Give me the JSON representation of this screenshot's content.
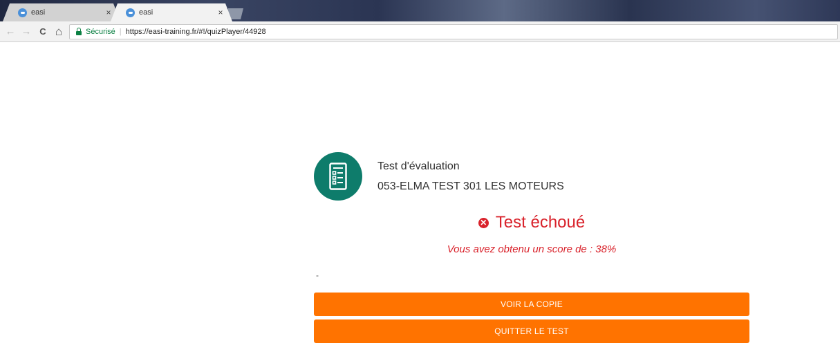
{
  "browser": {
    "tabs": [
      {
        "title": "easi",
        "active": false
      },
      {
        "title": "easi",
        "active": true
      }
    ],
    "close_glyph": "×",
    "nav": {
      "back": "←",
      "forward": "→",
      "reload": "C",
      "home": "⌂"
    },
    "address": {
      "security_label": "Sécurisé",
      "separator": "|",
      "url": "https://easi-training.fr/#!/quizPlayer/44928"
    }
  },
  "quiz": {
    "icon": "checklist-icon",
    "type": "Test d'évaluation",
    "name": "053-ELMA TEST 301 LES MOTEURS"
  },
  "result": {
    "icon": "fail-x-icon",
    "status_glyph": "✕",
    "status": "Test échoué",
    "score_text": "Vous avez obtenu un score de : 38%",
    "dash": "-"
  },
  "actions": {
    "view_copy": "VOIR LA COPIE",
    "quit": "QUITTER LE TEST"
  },
  "colors": {
    "accent_orange": "#ff7300",
    "fail_red": "#d9232c",
    "icon_teal": "#0e7c6b",
    "secure_green": "#0b8043"
  }
}
